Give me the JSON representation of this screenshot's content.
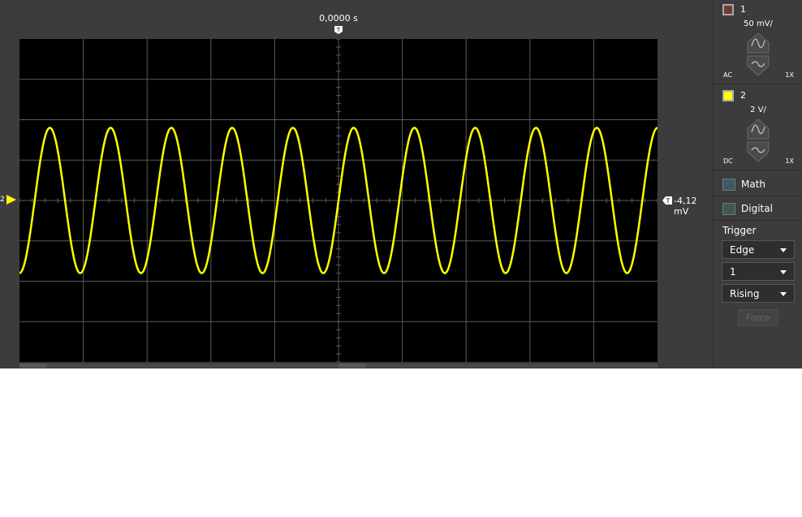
{
  "timebase": {
    "trigger_time": "0,0000 s"
  },
  "trigger_level": {
    "label": "-4,12 mV"
  },
  "channel_marker": {
    "label": "2"
  },
  "channels": [
    {
      "name": "1",
      "scale": "50 mV/",
      "coupling": "AC",
      "probe": "1X",
      "color": "#6b3a33"
    },
    {
      "name": "2",
      "scale": "2 V/",
      "coupling": "DC",
      "probe": "1X",
      "color": "#ffff00"
    }
  ],
  "menu": {
    "math": {
      "label": "Math",
      "color": "#3d5a66"
    },
    "digital": {
      "label": "Digital",
      "color": "#3e5a4e"
    }
  },
  "trigger": {
    "title": "Trigger",
    "type": "Edge",
    "source": "1",
    "slope": "Rising",
    "force_label": "Force"
  },
  "colors": {
    "trace": "#ffff00",
    "grid": "#5a5a5a",
    "background": "#000000",
    "panel": "#3c3c3c"
  },
  "chart_data": {
    "type": "line",
    "grid": true,
    "divisions": {
      "x": 10,
      "y": 8
    },
    "series": [
      {
        "channel": "2",
        "waveform": "sine",
        "cycles_on_screen": 10.5,
        "amplitude_divisions": 1.8,
        "offset_divisions": 0.0
      }
    ]
  }
}
